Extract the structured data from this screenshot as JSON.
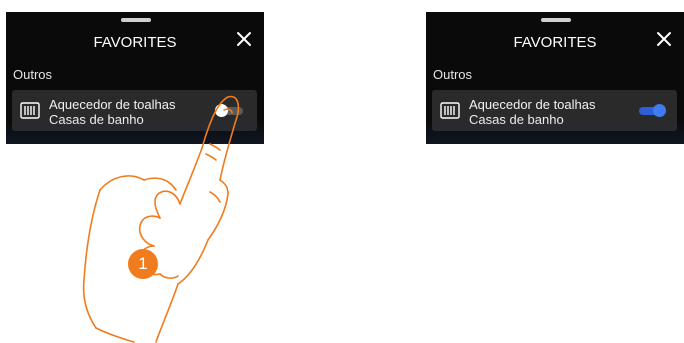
{
  "screens": [
    {
      "title": "FAVORITES",
      "close_icon": "close-icon",
      "section": "Outros",
      "item": {
        "icon": "radiator-icon",
        "name": "Aquecedor de toalhas",
        "location": "Casas de banho",
        "toggle_on": false
      }
    },
    {
      "title": "FAVORITES",
      "close_icon": "close-icon",
      "section": "Outros",
      "item": {
        "icon": "radiator-icon",
        "name": "Aquecedor de toalhas",
        "location": "Casas de banho",
        "toggle_on": true
      }
    }
  ],
  "step_badge": "1",
  "colors": {
    "panel_bg": "#0a0a0a",
    "row_bg": "#2a2a2a",
    "toggle_on": "#3f7cf2",
    "step_badge": "#f07c1e",
    "hand_outline": "#f07c1e"
  }
}
